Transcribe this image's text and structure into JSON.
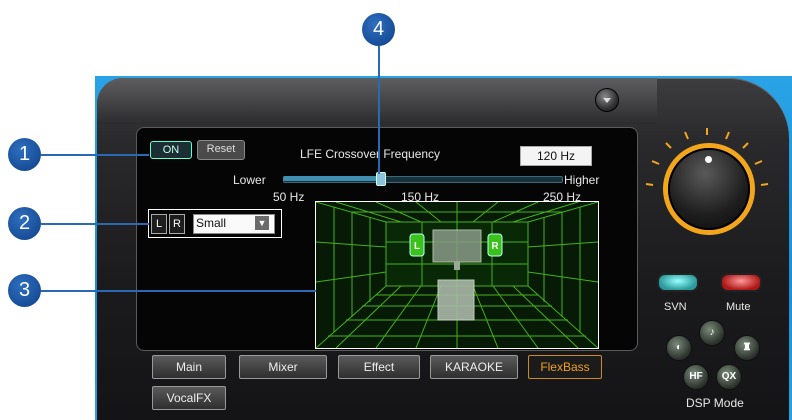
{
  "controls": {
    "on_label": "ON",
    "reset_label": "Reset"
  },
  "crossover": {
    "title": "LFE Crossover Frequency",
    "value": "120 Hz",
    "lower_label": "Lower",
    "higher_label": "Higher",
    "ticks": [
      "50 Hz",
      "150 Hz",
      "250 Hz"
    ],
    "slider_level_percent": 35
  },
  "speaker": {
    "left_label": "L",
    "right_label": "R",
    "size_value": "Small"
  },
  "room": {
    "left_label": "L",
    "right_label": "R"
  },
  "tabs": [
    {
      "label": "Main"
    },
    {
      "label": "Mixer"
    },
    {
      "label": "Effect"
    },
    {
      "label": "KARAOKE"
    },
    {
      "label": "FlexBass",
      "active": true
    },
    {
      "label": "VocalFX"
    }
  ],
  "right_panel": {
    "svn_label": "SVN",
    "mute_label": "Mute",
    "dsp_mode_label": "DSP Mode",
    "dsp_buttons": [
      "HF",
      "QX"
    ]
  },
  "callouts": [
    "1",
    "2",
    "3",
    "4"
  ],
  "colors": {
    "accent": "#f3a61c",
    "active_tab": "#f0a020",
    "callout": "#1a56a8",
    "backdrop": "#1b8ed8"
  }
}
